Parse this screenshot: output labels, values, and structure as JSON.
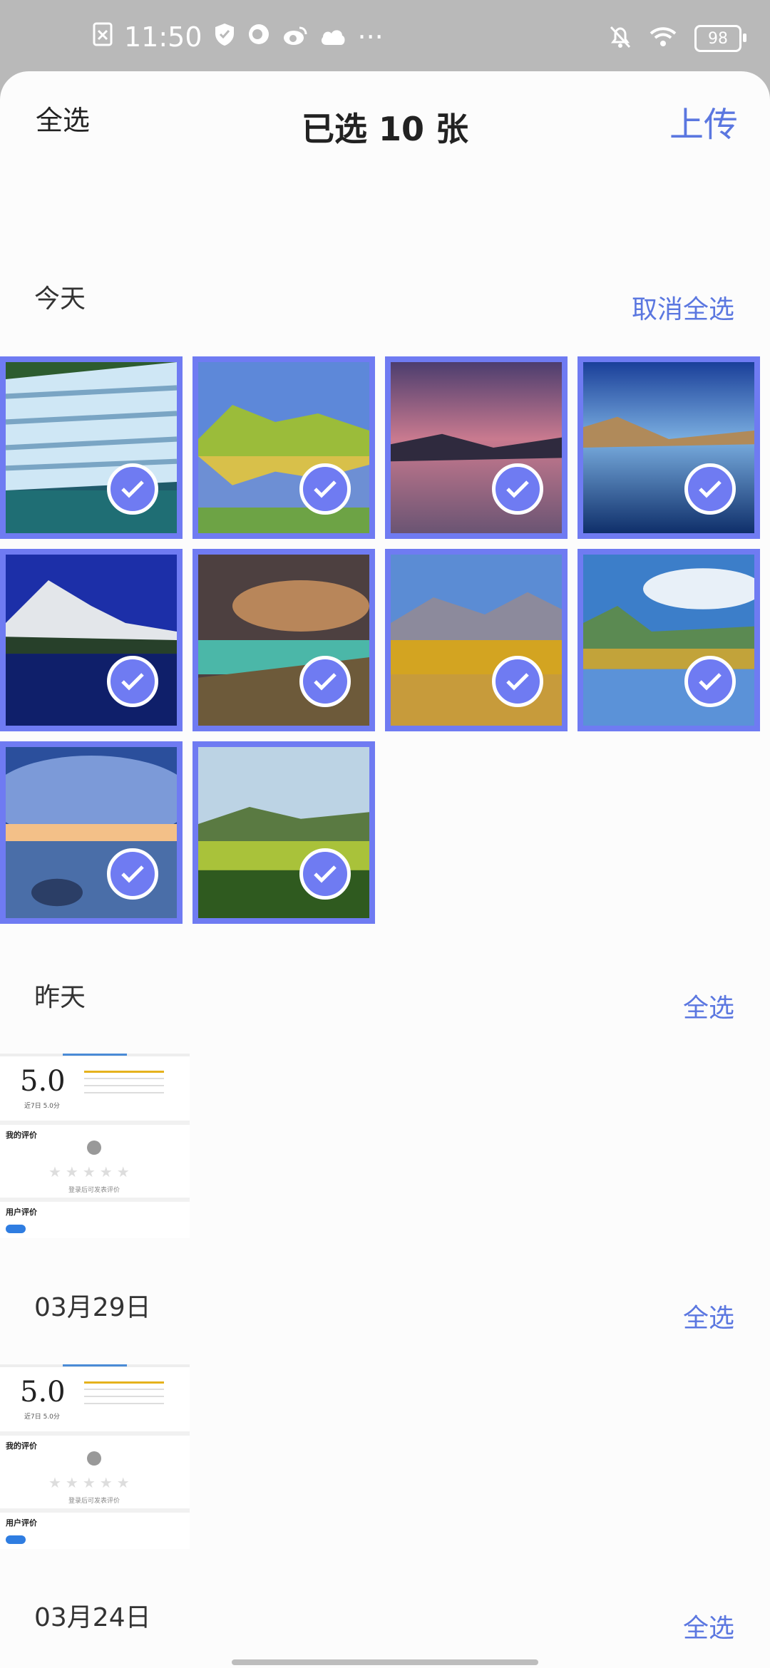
{
  "status_bar": {
    "time": "11:50",
    "battery": "98",
    "more": "···"
  },
  "header": {
    "select_all": "全选",
    "title": "已选 10 张",
    "upload": "上传"
  },
  "sections": [
    {
      "title": "今天",
      "action": "取消全选"
    },
    {
      "title": "昨天",
      "action": "全选"
    },
    {
      "title": "03月29日",
      "action": "全选"
    },
    {
      "title": "03月24日",
      "action": "全选"
    }
  ],
  "review": {
    "rating": "5.0",
    "rating_sub": "近7日 5.0分",
    "my_review": "我的评价",
    "hint": "登录后可发表评价",
    "user_review": "用户评价"
  },
  "colors": {
    "accent": "#5b77e0",
    "selected_border": "#6f7bf2"
  }
}
